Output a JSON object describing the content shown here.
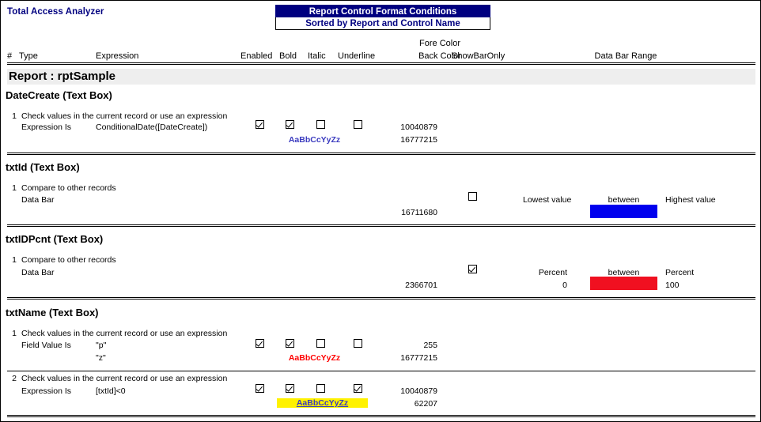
{
  "app": {
    "brand": "Total Access Analyzer",
    "report_title": "Report Control Format Conditions",
    "report_subtitle": "Sorted by Report and Control Name",
    "title_bar_color": "#000080",
    "title_text_color": "#FFFFFF",
    "subtitle_text_color": "#000080"
  },
  "columns": {
    "num": "#",
    "type": "Type",
    "expression": "Expression",
    "enabled": "Enabled",
    "bold": "Bold",
    "italic": "Italic",
    "underline": "Underline",
    "fore_color": "Fore Color",
    "back_color": "Back Color",
    "show_bar_only": "ShowBarOnly",
    "data_bar_range": "Data Bar Range"
  },
  "group": {
    "label": "Report : rptSample",
    "band_color": "#EEEEEE"
  },
  "controls": [
    {
      "name": "DateCreate (Text Box)",
      "rules": [
        {
          "num": "1",
          "description": "Check values in the current record or use an expression",
          "type": "Expression Is",
          "expression": "ConditionalDate([DateCreate])",
          "expression2": "",
          "enabled": true,
          "bold": true,
          "italic": false,
          "underline": false,
          "show_bar_only": null,
          "fore_color": "10040879",
          "back_color": "16777215",
          "sample_text": "AaBbCcYyZz",
          "sample_fore": "#3B3BBF",
          "sample_back": "#FFFFFF",
          "sample_underline": false,
          "databar": null
        }
      ]
    },
    {
      "name": "txtId (Text Box)",
      "rules": [
        {
          "num": "1",
          "description": "Compare to other records",
          "type": "Data Bar",
          "expression": "",
          "expression2": "",
          "enabled": null,
          "bold": null,
          "italic": null,
          "underline": null,
          "show_bar_only": false,
          "fore_color": "",
          "back_color": "16711680",
          "sample_text": "",
          "sample_fore": "",
          "sample_back": "",
          "sample_underline": false,
          "databar": {
            "left_label": "Lowest value",
            "left_value": "",
            "middle_label": "between",
            "right_label": "Highest value",
            "right_value": "",
            "bar_color": "#0000EE"
          }
        }
      ]
    },
    {
      "name": "txtIDPcnt (Text Box)",
      "rules": [
        {
          "num": "1",
          "description": "Compare to other records",
          "type": "Data Bar",
          "expression": "",
          "expression2": "",
          "enabled": null,
          "bold": null,
          "italic": null,
          "underline": null,
          "show_bar_only": true,
          "fore_color": "",
          "back_color": "2366701",
          "sample_text": "",
          "sample_fore": "",
          "sample_back": "",
          "sample_underline": false,
          "databar": {
            "left_label": "Percent",
            "left_value": "0",
            "middle_label": "between",
            "right_label": "Percent",
            "right_value": "100",
            "bar_color": "#F01020"
          }
        }
      ]
    },
    {
      "name": "txtName (Text Box)",
      "rules": [
        {
          "num": "1",
          "description": "Check values in the current record or use an expression",
          "type": "Field Value Is",
          "expression": "\"p\"",
          "expression2": "\"z\"",
          "enabled": true,
          "bold": true,
          "italic": false,
          "underline": false,
          "show_bar_only": null,
          "fore_color": "255",
          "back_color": "16777215",
          "sample_text": "AaBbCcYyZz",
          "sample_fore": "#FF0000",
          "sample_back": "#FFFFFF",
          "sample_underline": false,
          "databar": null
        },
        {
          "num": "2",
          "description": "Check values in the current record or use an expression",
          "type": "Expression Is",
          "expression": "[txtId]<0",
          "expression2": "",
          "enabled": true,
          "bold": true,
          "italic": false,
          "underline": true,
          "show_bar_only": null,
          "fore_color": "10040879",
          "back_color": "62207",
          "sample_text": "AaBbCcYyZz",
          "sample_fore": "#3B3BBF",
          "sample_back": "#FFF200",
          "sample_underline": true,
          "databar": null
        }
      ]
    }
  ]
}
